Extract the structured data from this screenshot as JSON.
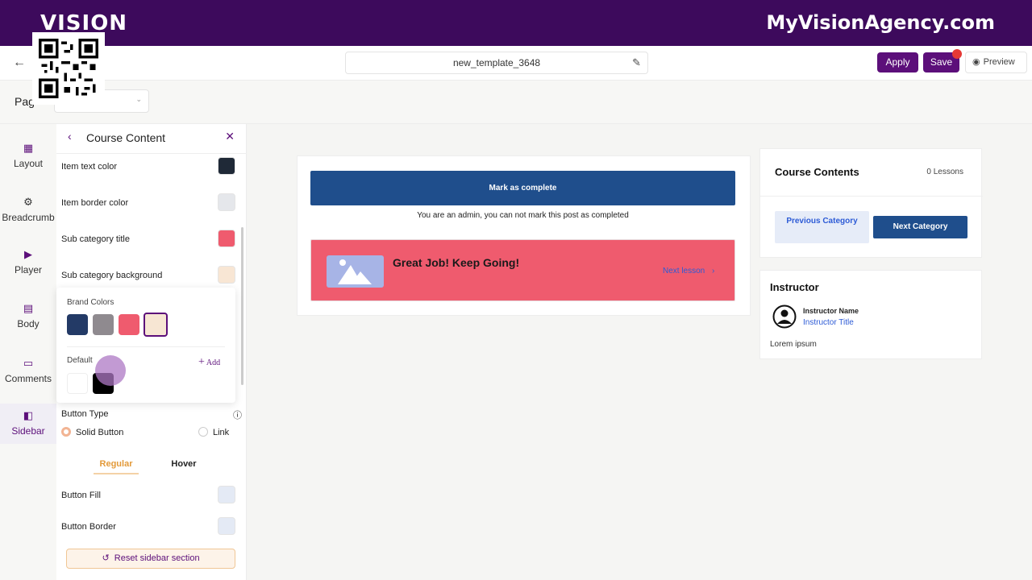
{
  "brand": {
    "logo_text": "VISION",
    "site_name": "MyVisionAgency.com"
  },
  "header": {
    "template_name": "new_template_3648",
    "apply_label": "Apply",
    "save_label": "Save",
    "preview_label": "Preview"
  },
  "page_row": {
    "label": "Pag"
  },
  "leftnav": {
    "items": [
      {
        "label": "Layout",
        "icon": "layout-icon"
      },
      {
        "label": "Breadcrumb",
        "icon": "breadcrumb-icon"
      },
      {
        "label": "Player",
        "icon": "video-icon"
      },
      {
        "label": "Body",
        "icon": "document-icon"
      },
      {
        "label": "Comments",
        "icon": "comment-icon"
      },
      {
        "label": "Sidebar",
        "icon": "sidebar-icon",
        "active": true
      }
    ]
  },
  "panel": {
    "title": "Course Content",
    "rows": [
      {
        "label": "Item text color",
        "color": "#1f2937"
      },
      {
        "label": "Item border color",
        "color": "#e5e7eb"
      },
      {
        "label": "Sub category title",
        "color": "#ef5b6e"
      },
      {
        "label": "Sub category background",
        "color": "#f8e6d4"
      }
    ],
    "popover": {
      "brand_label": "Brand Colors",
      "brand_colors": [
        "#233a66",
        "#8f8a8f",
        "#ef5b6e",
        "#f7e6d3"
      ],
      "default_label": "Default",
      "add_label": "Add",
      "default_colors": [
        "#ffffff",
        "#000000"
      ]
    },
    "button_type": {
      "label": "Button Type",
      "option_solid": "Solid Button",
      "option_link": "Link"
    },
    "tabs": {
      "regular": "Regular",
      "hover": "Hover"
    },
    "button_rows": [
      {
        "label": "Button Fill",
        "color": "#e4eaf5"
      },
      {
        "label": "Button Border",
        "color": "#e4eaf5"
      }
    ],
    "reset_label": "Reset sidebar section"
  },
  "canvas": {
    "mark_complete": "Mark as complete",
    "admin_note": "You are an admin, you can not mark this post as completed",
    "great_title": "Great Job! Keep Going!",
    "next_lesson": "Next lesson",
    "course_contents": {
      "title": "Course Contents",
      "count": "0 Lessons",
      "prev_label": "Previous Category",
      "next_label": "Next Category"
    },
    "instructor": {
      "title": "Instructor",
      "name": "Instructor Name",
      "role": "Instructor Title",
      "bio": "Lorem ipsum"
    }
  },
  "colors": {
    "brand_purple": "#3d0a5c",
    "button_purple": "#5c0f7a",
    "primary_blue": "#1f4e8c",
    "banner_pink": "#ef5b6e",
    "accent_orange": "#e39a3a"
  }
}
